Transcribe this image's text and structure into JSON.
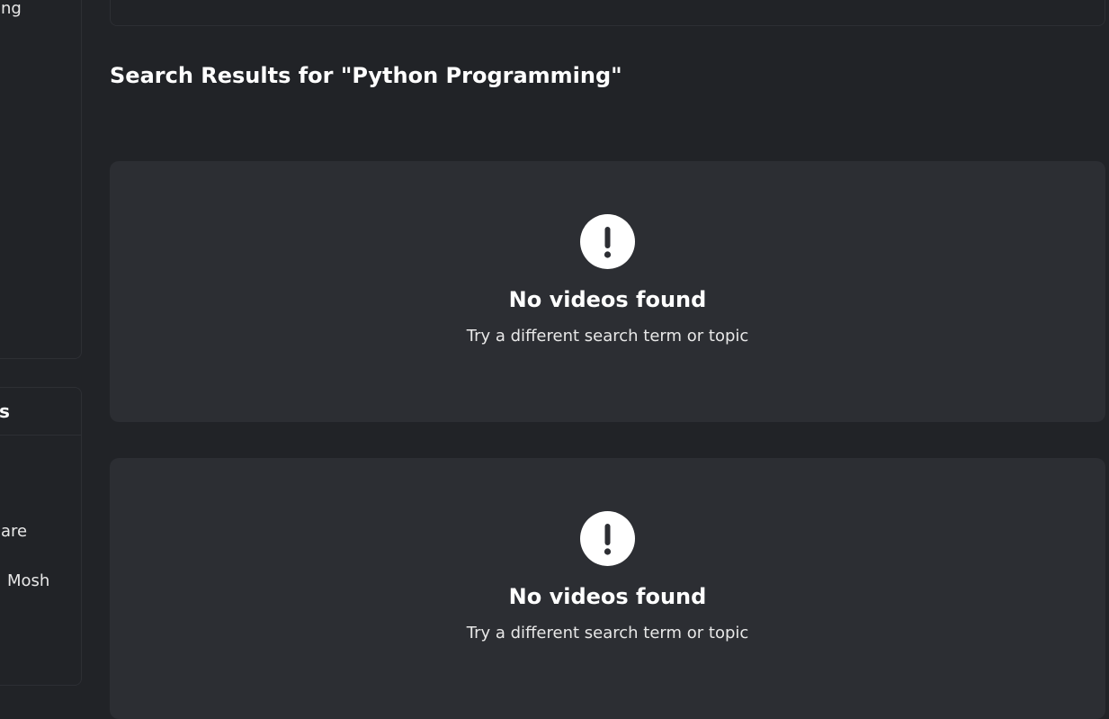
{
  "sidebar": {
    "top_panel_text": "ng",
    "bottom_panel": {
      "header": "s",
      "items": [
        {
          "label": "are"
        },
        {
          "label": "Mosh"
        }
      ]
    }
  },
  "main": {
    "results_title": "Search Results for \"Python Programming\"",
    "empty_states": [
      {
        "title": "No videos found",
        "subtitle": "Try a different search term or topic"
      },
      {
        "title": "No videos found",
        "subtitle": "Try a different search term or topic"
      }
    ]
  },
  "icons": {
    "empty_state": "alert-circle-icon"
  }
}
